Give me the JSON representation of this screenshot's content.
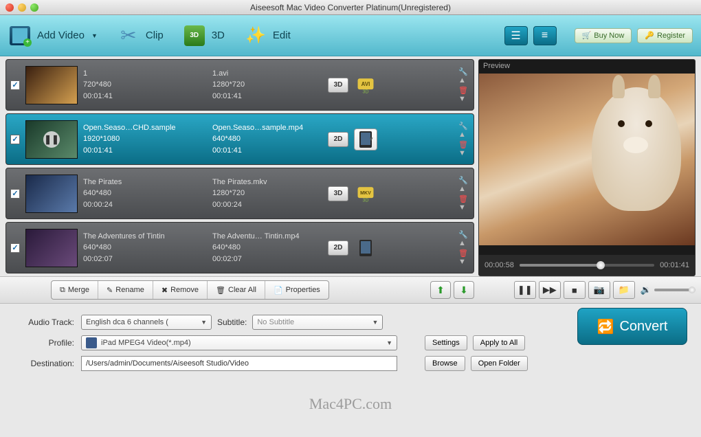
{
  "window": {
    "title": "Aiseesoft Mac Video Converter Platinum(Unregistered)"
  },
  "toolbar": {
    "addVideo": "Add Video",
    "clip": "Clip",
    "threeD": "3D",
    "edit": "Edit",
    "buyNow": "Buy Now",
    "register": "Register"
  },
  "items": [
    {
      "checked": true,
      "title": "1",
      "res": "720*480",
      "dur": "00:01:41",
      "outName": "1.avi",
      "outRes": "1280*720",
      "outDur": "00:01:41",
      "badge": "3D",
      "fmt": "AVI",
      "fmtStyle": "avi"
    },
    {
      "checked": true,
      "title": "Open.Seaso…CHD.sample",
      "res": "1920*1080",
      "dur": "00:01:41",
      "outName": "Open.Seaso…sample.mp4",
      "outRes": "640*480",
      "outDur": "00:01:41",
      "badge": "2D",
      "fmt": "iPad",
      "fmtStyle": "ipad-dd",
      "selected": true
    },
    {
      "checked": true,
      "title": "The Pirates",
      "res": "640*480",
      "dur": "00:00:24",
      "outName": "The Pirates.mkv",
      "outRes": "1280*720",
      "outDur": "00:00:24",
      "badge": "3D",
      "fmt": "MKV",
      "fmtStyle": "mkv"
    },
    {
      "checked": true,
      "title": "The Adventures of Tintin",
      "res": "640*480",
      "dur": "00:02:07",
      "outName": "The Adventu… Tintin.mp4",
      "outRes": "640*480",
      "outDur": "00:02:07",
      "badge": "2D",
      "fmt": "iPad",
      "fmtStyle": "ipad"
    }
  ],
  "preview": {
    "label": "Preview",
    "timeCurrent": "00:00:58",
    "timeTotal": "00:01:41"
  },
  "actions": {
    "merge": "Merge",
    "rename": "Rename",
    "remove": "Remove",
    "clearAll": "Clear All",
    "properties": "Properties"
  },
  "settings": {
    "audioTrackLabel": "Audio Track:",
    "audioTrack": "English dca 6 channels (",
    "subtitleLabel": "Subtitle:",
    "subtitle": "No Subtitle",
    "profileLabel": "Profile:",
    "profile": "iPad MPEG4 Video(*.mp4)",
    "settingsBtn": "Settings",
    "applyAll": "Apply to All",
    "destLabel": "Destination:",
    "dest": "/Users/admin/Documents/Aiseesoft Studio/Video",
    "browse": "Browse",
    "openFolder": "Open Folder",
    "convert": "Convert"
  },
  "watermark": "Mac4PC.com"
}
